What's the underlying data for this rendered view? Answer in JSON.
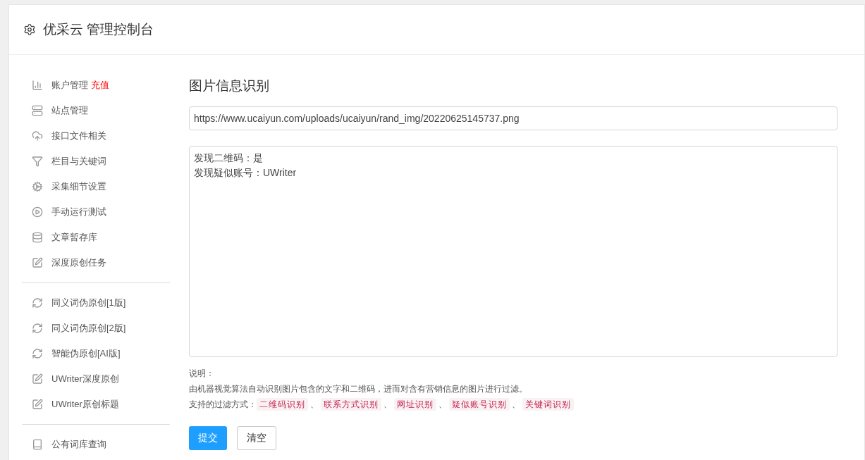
{
  "header": {
    "title": "优采云 管理控制台"
  },
  "sidebar": {
    "groups": [
      {
        "items": [
          {
            "label": "账户管理",
            "badge": "充值"
          },
          {
            "label": "站点管理"
          },
          {
            "label": "接口文件相关"
          },
          {
            "label": "栏目与关键词"
          },
          {
            "label": "采集细节设置"
          },
          {
            "label": "手动运行测试"
          },
          {
            "label": "文章暂存库"
          },
          {
            "label": "深度原创任务"
          }
        ]
      },
      {
        "items": [
          {
            "label": "同义词伪原创[1版]"
          },
          {
            "label": "同义词伪原创[2版]"
          },
          {
            "label": "智能伪原创[AI版]"
          },
          {
            "label": "UWriter深度原创"
          },
          {
            "label": "UWriter原创标题"
          }
        ]
      },
      {
        "items": [
          {
            "label": "公有词库查询"
          }
        ]
      }
    ]
  },
  "main": {
    "title": "图片信息识别",
    "url_field": {
      "value": "https://www.ucaiyun.com/uploads/ucaiyun/rand_img/20220625145737.png"
    },
    "result_box": {
      "lines": [
        "发现二维码：是",
        "发现疑似账号：UWriter"
      ]
    },
    "notes": {
      "heading": "说明：",
      "description": "由机器视觉算法自动识别图片包含的文字和二维码，进而对含有营销信息的图片进行过滤。",
      "filters_label": "支持的过滤方式：",
      "tags": [
        {
          "text": "二维码识别",
          "after": "、"
        },
        {
          "text": "联系方式识别",
          "after": "、"
        },
        {
          "text": "网址识别",
          "after": "、"
        },
        {
          "text": "疑似账号识别",
          "after": "、"
        },
        {
          "text": "关键词识别"
        }
      ]
    },
    "buttons": [
      {
        "label": "提交",
        "kind": "primary"
      },
      {
        "label": "清空",
        "kind": "default"
      }
    ]
  }
}
